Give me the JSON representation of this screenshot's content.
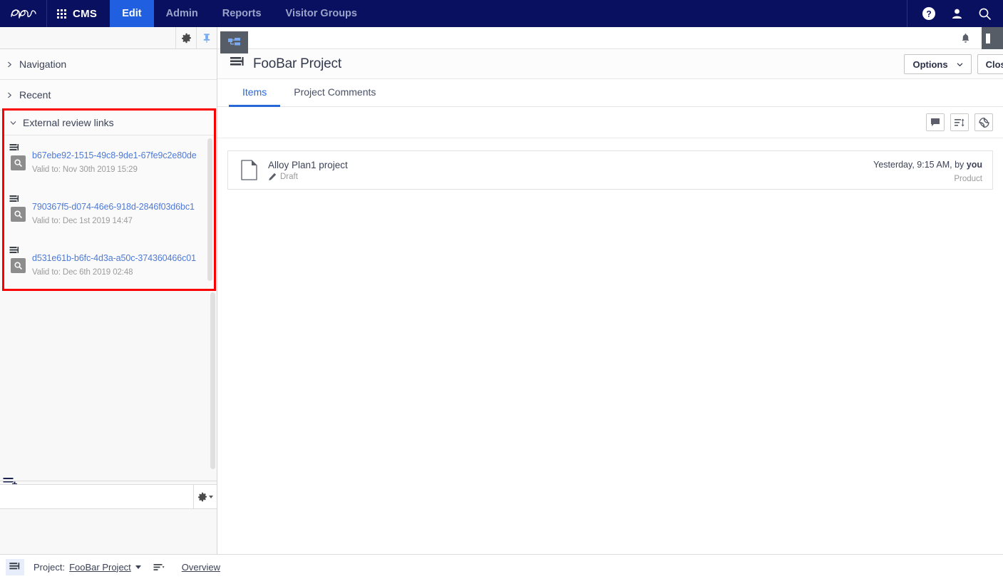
{
  "topbar": {
    "logo_icon": "epi-logo",
    "apps_icon": "grid-apps-icon",
    "product": "CMS",
    "nav": [
      {
        "label": "Edit",
        "active": true
      },
      {
        "label": "Admin",
        "active": false
      },
      {
        "label": "Reports",
        "active": false
      },
      {
        "label": "Visitor Groups",
        "active": false
      }
    ],
    "help_icon": "help-circle-icon",
    "user_icon": "user-icon",
    "search_icon": "search-icon"
  },
  "left_panel": {
    "toolbar": {
      "settings_icon": "gear-icon",
      "pin_icon": "pin-icon"
    },
    "sections": [
      {
        "label": "Navigation",
        "expanded": false
      },
      {
        "label": "Recent",
        "expanded": false
      }
    ],
    "external_review": {
      "title": "External review links",
      "expanded": true,
      "highlight_color": "#fb0000",
      "items": [
        {
          "id": "b67ebe92-1515-49c8-9de1-67fe9c2e80de",
          "valid_to": "Valid to: Nov 30th 2019 15:29",
          "stack_icon": "list-stack-icon",
          "preview_icon": "magnifier-icon"
        },
        {
          "id": "790367f5-d074-46e6-918d-2846f03d6bc1",
          "valid_to": "Valid to: Dec 1st 2019 14:47",
          "stack_icon": "list-stack-icon",
          "preview_icon": "magnifier-icon"
        },
        {
          "id": "d531e61b-b6fc-4d3a-a50c-374360466c01",
          "valid_to": "Valid to: Dec 6th 2019 02:48",
          "stack_icon": "list-stack-icon",
          "preview_icon": "magnifier-icon"
        }
      ]
    },
    "add_list_icon": "add-list-icon",
    "search_placeholder": "",
    "search_value": "",
    "search_settings_icon": "gear-dropdown-icon"
  },
  "main": {
    "tree_toggle_icon": "hierarchy-tree-icon",
    "notifications_icon": "bell-icon",
    "panel_toggle_icon": "panel-toggle-icon",
    "page": {
      "icon": "project-stack-icon",
      "title": "FooBar Project"
    },
    "actions": {
      "options_label": "Options",
      "options_chevron_icon": "chevron-down-icon",
      "close_label": "Close"
    },
    "tabs": [
      {
        "label": "Items",
        "active": true
      },
      {
        "label": "Project Comments",
        "active": false
      }
    ],
    "list_toolbar": [
      {
        "icon": "comment-icon",
        "name": "comments-button"
      },
      {
        "icon": "sort-icon",
        "name": "sort-button"
      },
      {
        "icon": "refresh-icon",
        "name": "refresh-button"
      }
    ],
    "items": [
      {
        "doc_icon": "document-icon",
        "name": "Alloy Plan1 project",
        "status_icon": "pencil-icon",
        "status": "Draft",
        "when_prefix": "Yesterday, 9:15 AM, by ",
        "when_author": "you",
        "category": "Product"
      }
    ]
  },
  "statusbar": {
    "icon": "project-stack-icon",
    "label": "Project:",
    "project_name": "FooBar Project",
    "project_caret_icon": "caret-down-icon",
    "list_icon": "list-dropdown-icon",
    "overview_label": "Overview"
  }
}
